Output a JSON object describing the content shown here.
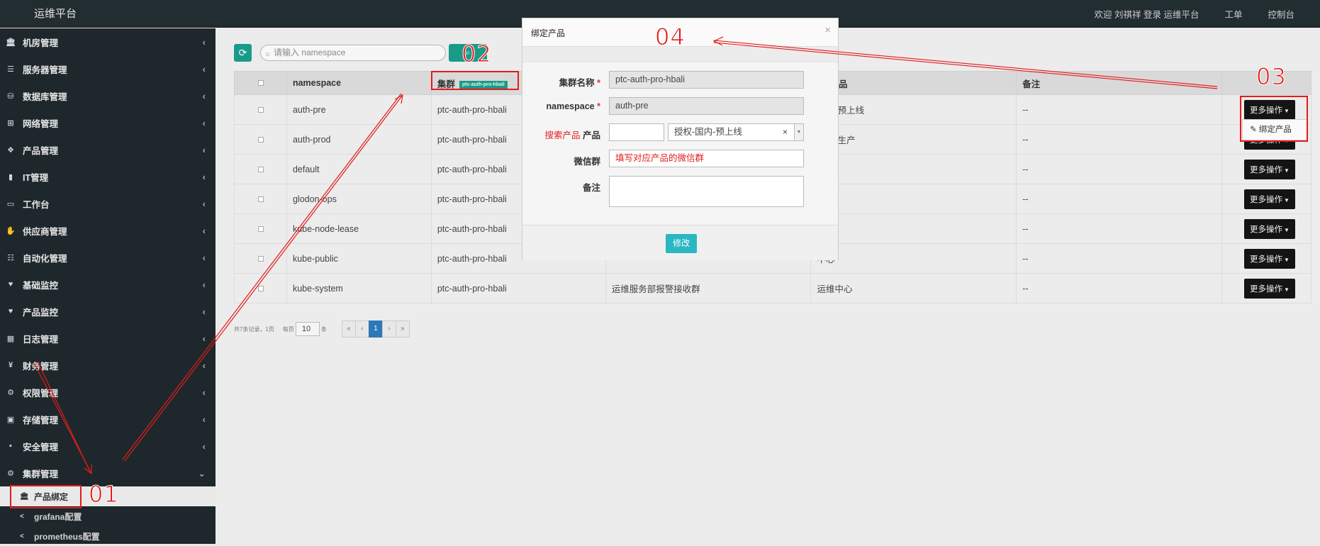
{
  "topbar": {
    "brand": "运维平台",
    "welcome": "欢迎 刘祺祥 登录 运维平台",
    "workorder": "工单",
    "console": "控制台"
  },
  "sidebar": {
    "items": [
      {
        "label": "机房管理",
        "icon": "bank-icon"
      },
      {
        "label": "服务器管理",
        "icon": "server-icon"
      },
      {
        "label": "数据库管理",
        "icon": "database-icon"
      },
      {
        "label": "网络管理",
        "icon": "sitemap-icon"
      },
      {
        "label": "产品管理",
        "icon": "cubes-icon"
      },
      {
        "label": "IT管理",
        "icon": "it-icon"
      },
      {
        "label": "工作台",
        "icon": "desktop-icon"
      },
      {
        "label": "供应商管理",
        "icon": "handshake-icon"
      },
      {
        "label": "自动化管理",
        "icon": "sliders-icon"
      },
      {
        "label": "基础监控",
        "icon": "heartbeat-icon"
      },
      {
        "label": "产品监控",
        "icon": "heartbeat-icon"
      },
      {
        "label": "日志管理",
        "icon": "calendar-icon"
      },
      {
        "label": "财务管理",
        "icon": "yen-icon"
      },
      {
        "label": "权限管理",
        "icon": "gears-icon"
      },
      {
        "label": "存储管理",
        "icon": "briefcase-icon"
      },
      {
        "label": "安全管理",
        "icon": "lock-icon"
      },
      {
        "label": "集群管理",
        "icon": "gears-icon"
      }
    ],
    "subitems": [
      {
        "label": "产品绑定",
        "icon": "bank-icon"
      },
      {
        "label": "grafana配置",
        "icon": "share-icon"
      },
      {
        "label": "prometheus配置",
        "icon": "share-icon"
      }
    ]
  },
  "toolbar": {
    "search_placeholder": "请输入 namespace"
  },
  "table": {
    "headers": {
      "namespace": "namespace",
      "cluster": "集群",
      "cluster_tag": "ptc-auth-pro-hbali",
      "product": "产品",
      "remark": "备注"
    },
    "rows": [
      {
        "namespace": "auth-pre",
        "cluster": "ptc-auth-pro-hbali",
        "product": "国内-预上线",
        "remark": "--"
      },
      {
        "namespace": "auth-prod",
        "cluster": "ptc-auth-pro-hbali",
        "product": "国内-生产",
        "remark": "--"
      },
      {
        "namespace": "default",
        "cluster": "ptc-auth-pro-hbali",
        "product": "",
        "remark": "--"
      },
      {
        "namespace": "glodon-ops",
        "cluster": "ptc-auth-pro-hbali",
        "product": "中心",
        "remark": "--"
      },
      {
        "namespace": "kube-node-lease",
        "cluster": "ptc-auth-pro-hbali",
        "product": "",
        "remark": "--"
      },
      {
        "namespace": "kube-public",
        "cluster": "ptc-auth-pro-hbali",
        "product": "中心",
        "remark": "--"
      },
      {
        "namespace": "kube-system",
        "cluster": "ptc-auth-pro-hbali",
        "wechat": "运维服务部报警接收群",
        "product": "运维中心",
        "remark": "--"
      }
    ],
    "ops_label": "更多操作",
    "dropdown_item": "绑定产品"
  },
  "pager": {
    "summary": "共7条记录，1页",
    "per_page_label": "每页",
    "per_page": "10",
    "unit": "条",
    "first": "«",
    "prev": "‹",
    "current": "1",
    "next": "›",
    "last": "»"
  },
  "modal": {
    "title": "绑定产品",
    "close": "×",
    "cluster_label": "集群名称",
    "cluster_value": "ptc-auth-pro-hbali",
    "namespace_label": "namespace",
    "namespace_value": "auth-pre",
    "required_mark": "*",
    "search_hint": "搜索产品",
    "product_label": "产品",
    "product_value": "授权-国内-预上线",
    "clear": "×",
    "wechat_label": "微信群",
    "wechat_value": "填写对应产品的微信群",
    "remark_label": "备注",
    "submit": "修改"
  },
  "annotations": {
    "n01": "01",
    "n02": "02",
    "n03": "03",
    "n04": "04",
    "color": "#e31b1b"
  }
}
